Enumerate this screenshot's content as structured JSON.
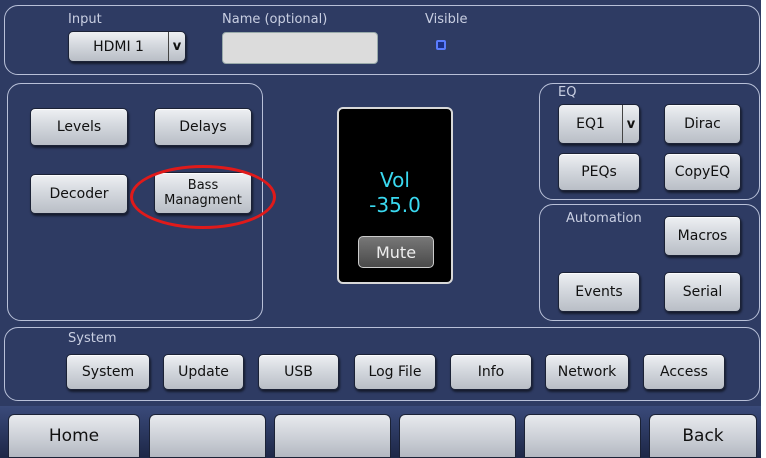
{
  "input_section": {
    "input_label": "Input",
    "input_value": "HDMI 1",
    "dropdown_arrow": "v",
    "name_label": "Name (optional)",
    "name_value": "",
    "visible_label": "Visible",
    "visible_checked": true
  },
  "main_buttons": {
    "levels": "Levels",
    "delays": "Delays",
    "decoder": "Decoder",
    "bass_line1": "Bass",
    "bass_line2": "Managment"
  },
  "volume": {
    "label": "Vol",
    "value": "-35.0",
    "mute": "Mute"
  },
  "eq": {
    "title": "EQ",
    "preset_value": "EQ1",
    "dropdown_arrow": "v",
    "dirac": "Dirac",
    "peqs": "PEQs",
    "copyeq": "CopyEQ"
  },
  "automation": {
    "title": "Automation",
    "macros": "Macros",
    "events": "Events",
    "serial": "Serial"
  },
  "system": {
    "title": "System",
    "buttons": [
      "System",
      "Update",
      "USB",
      "Log File",
      "Info",
      "Network",
      "Access"
    ]
  },
  "bottom_bar": {
    "home": "Home",
    "back": "Back"
  },
  "colors": {
    "background": "#2e3b63",
    "volume_text": "#3ad9f0",
    "highlight_ring": "#e01a1a"
  }
}
